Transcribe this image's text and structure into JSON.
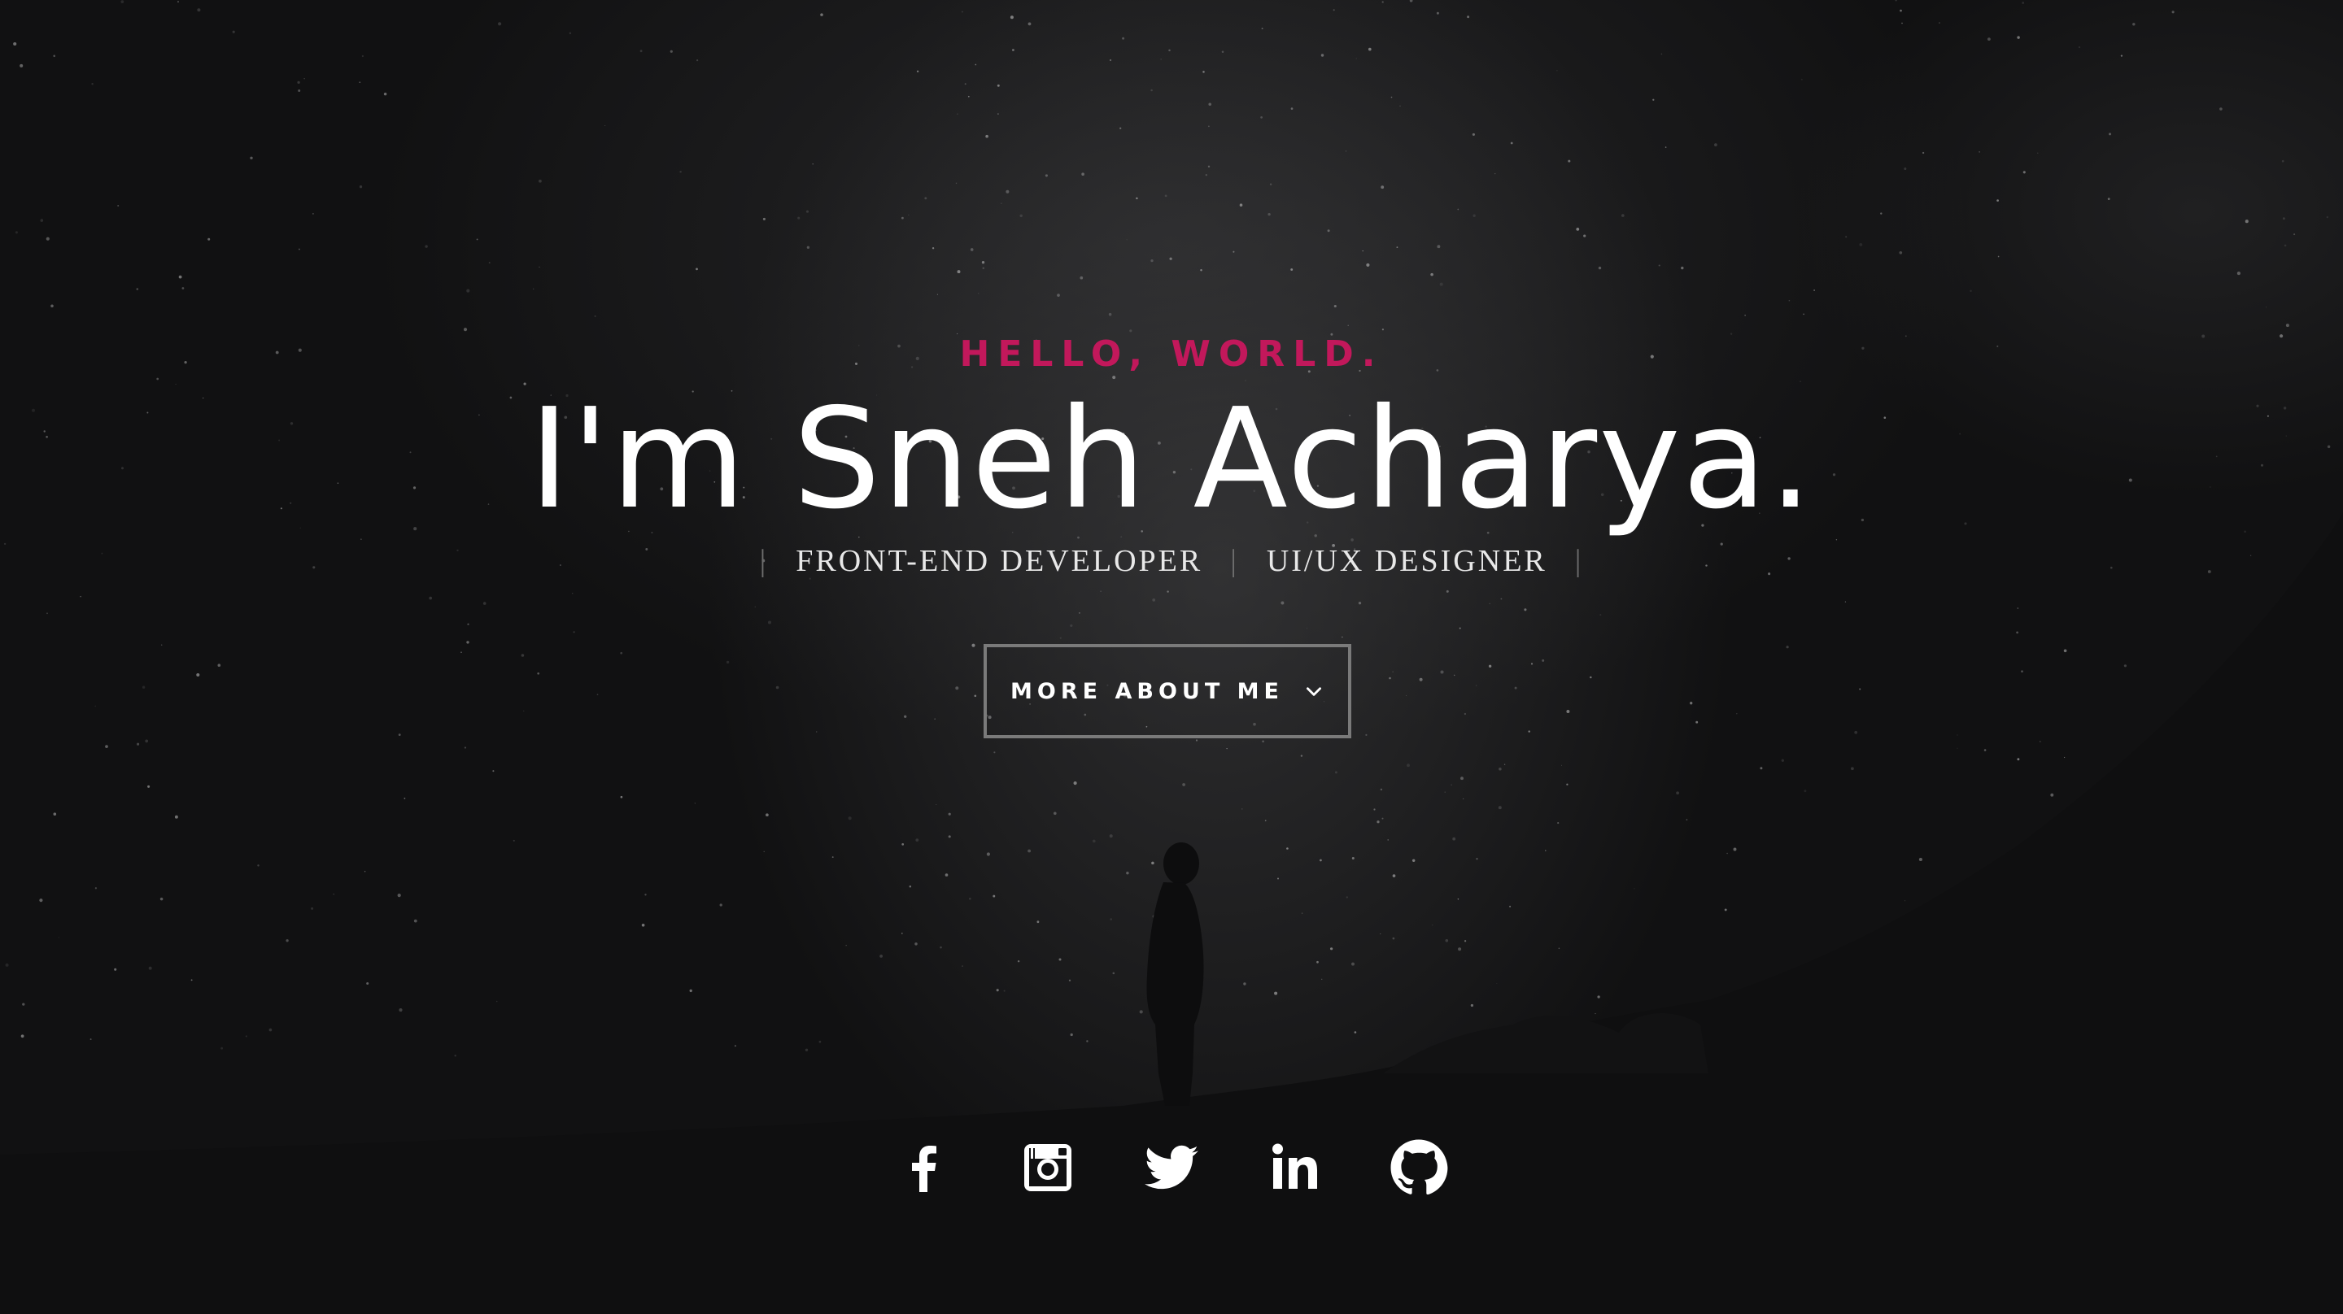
{
  "hero": {
    "greeting": "HELLO, WORLD.",
    "name": "I'm Sneh Acharya.",
    "roles": [
      "FRONT-END DEVELOPER",
      "UI/UX DESIGNER"
    ],
    "separator": "|",
    "cta_label": "MORE ABOUT ME",
    "accent_color": "#c2185b",
    "background_color": "#111112"
  },
  "social": {
    "icons": [
      "facebook-icon",
      "instagram-icon",
      "twitter-icon",
      "linkedin-icon",
      "github-icon"
    ]
  }
}
